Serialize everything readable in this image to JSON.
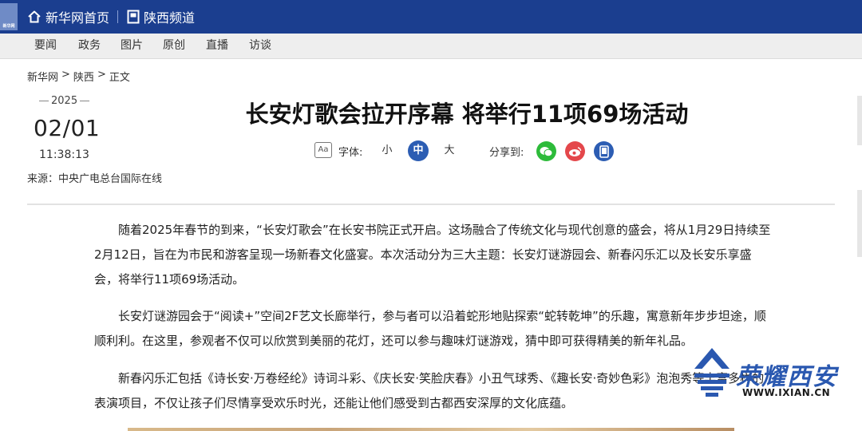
{
  "header": {
    "home_label": "新华网首页",
    "channel_label": "陕西频道",
    "logo_text": "新华网"
  },
  "subnav": [
    "要闻",
    "政务",
    "图片",
    "原创",
    "直播",
    "访谈"
  ],
  "breadcrumb": {
    "items": [
      "新华网",
      "陕西",
      "正文"
    ],
    "separator": ">"
  },
  "article": {
    "year": "2025",
    "date": "02/01",
    "time": "11:38:13",
    "source": "来源：中央广电总台国际在线",
    "title": "长安灯歌会拉开序幕 将举行11项69场活动",
    "font_label": "字体:",
    "font_sizes": [
      "小",
      "中",
      "大"
    ],
    "font_size_selected": "中",
    "share_label": "分享到:",
    "share_targets": [
      "wechat-icon",
      "weibo-icon",
      "mobile-icon"
    ],
    "paragraphs": [
      "随着2025年春节的到来，“长安灯歌会”在长安书院正式开启。这场融合了传统文化与现代创意的盛会，将从1月29日持续至2月12日，旨在为市民和游客呈现一场新春文化盛宴。本次活动分为三大主题：长安灯谜游园会、新春闪乐汇以及长安乐享盛会，将举行11项69场活动。",
      "长安灯谜游园会于“阅读+”空间2F艺文长廊举行，参与者可以沿着蛇形地贴探索“蛇转乾坤”的乐趣，寓意新年步步坦途，顺顺利利。在这里，参观者不仅可以欣赏到美丽的花灯，还可以参与趣味灯谜游戏，猜中即可获得精美的新年礼品。",
      "新春闪乐汇包括《诗长安·万卷经纶》诗词斗彩、《庆长安·笑脸庆春》小丑气球秀、《趣长安·奇妙色彩》泡泡秀等丰富多样的表演项目，不仅让孩子们尽情享受欢乐时光，还能让他们感受到古都西安深厚的文化底蕴。"
    ]
  },
  "watermark": {
    "text": "荣耀西安",
    "url": "WWW.IXIAN.CN"
  },
  "colors": {
    "topbar": "#1b3e8f",
    "accent": "#2c5db3",
    "wechat": "#2dbb3a",
    "weibo": "#e4474b",
    "mobile": "#2c5db3"
  }
}
